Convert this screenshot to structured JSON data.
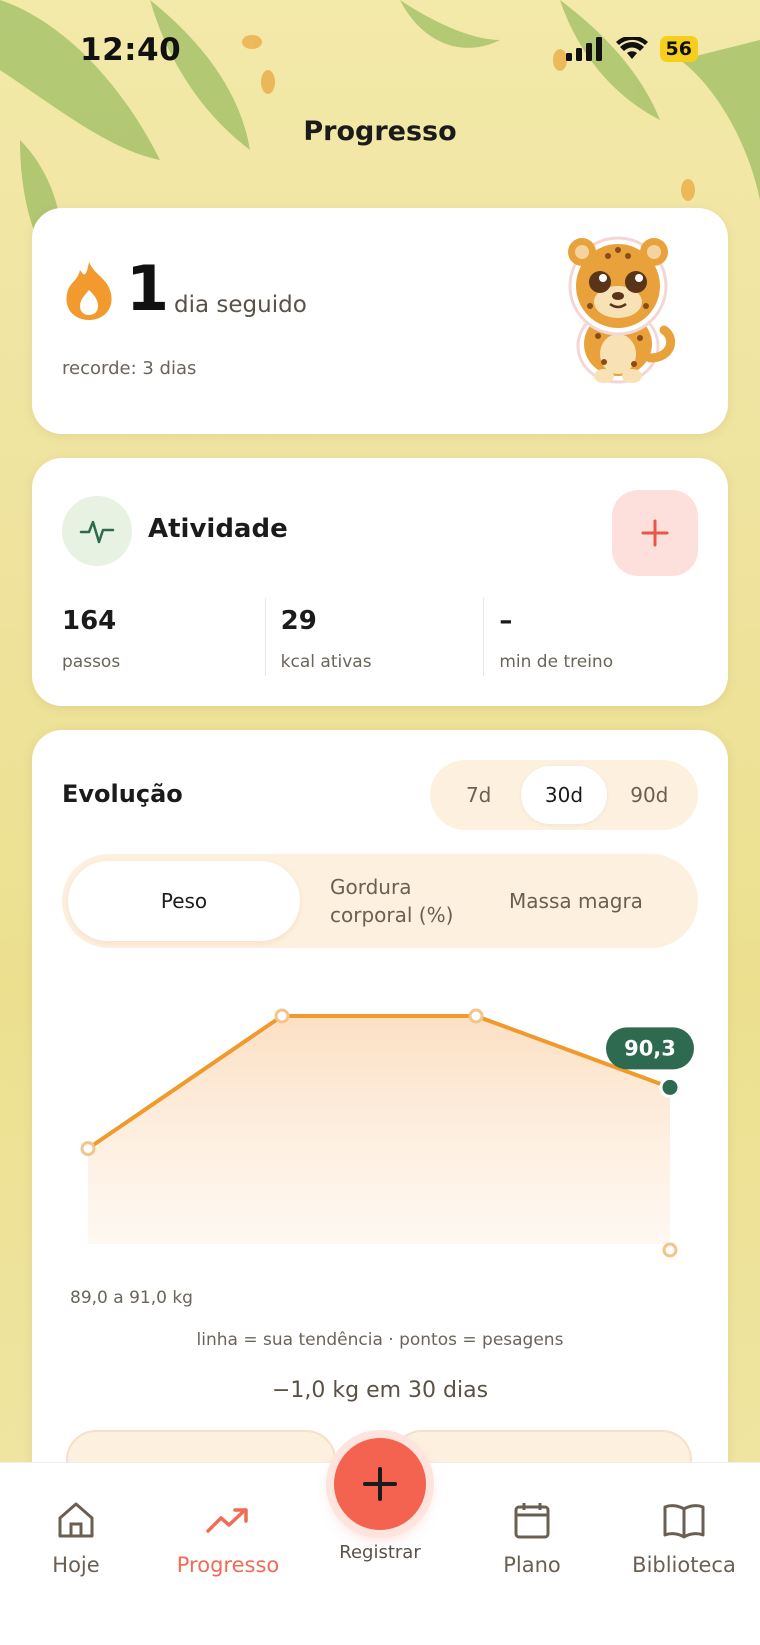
{
  "status": {
    "time": "12:40",
    "battery": "56"
  },
  "title": "Progresso",
  "streak": {
    "count": "1",
    "unit": "dia seguido",
    "record": "recorde: 3 dias"
  },
  "activity": {
    "title": "Atividade",
    "add_label": "+",
    "stats": [
      {
        "value": "164",
        "label": "passos"
      },
      {
        "value": "29",
        "label": "kcal ativas"
      },
      {
        "value": "–",
        "label": "min de treino"
      }
    ]
  },
  "evolution": {
    "title": "Evolução",
    "ranges": [
      "7d",
      "30d",
      "90d"
    ],
    "selected_range": "30d",
    "metrics": [
      "Peso",
      "Gordura corporal (%)",
      "Massa magra"
    ],
    "selected_metric": "Peso",
    "range_label": "89,0 a 91,0 kg",
    "legend": "linha = sua tendência · pontos = pesagens",
    "delta": "−1,0 kg em 30 dias"
  },
  "chart_data": {
    "type": "line",
    "series": [
      {
        "values": [
          89.7,
          91.0,
          91.0,
          90.3
        ]
      }
    ],
    "highlight_label": "90,3",
    "ylim": [
      89.0,
      91.0
    ],
    "colors": {
      "line": "#ef9a2b",
      "fill": "#fde6cf",
      "highlight": "#2e6a4f"
    }
  },
  "nav": {
    "items": [
      {
        "label": "Hoje",
        "icon": "home-icon"
      },
      {
        "label": "Progresso",
        "icon": "trend-up-icon"
      },
      {
        "label": "Plano",
        "icon": "calendar-icon"
      },
      {
        "label": "Biblioteca",
        "icon": "book-icon"
      }
    ],
    "fab_label": "Registrar",
    "active": "Progresso"
  }
}
